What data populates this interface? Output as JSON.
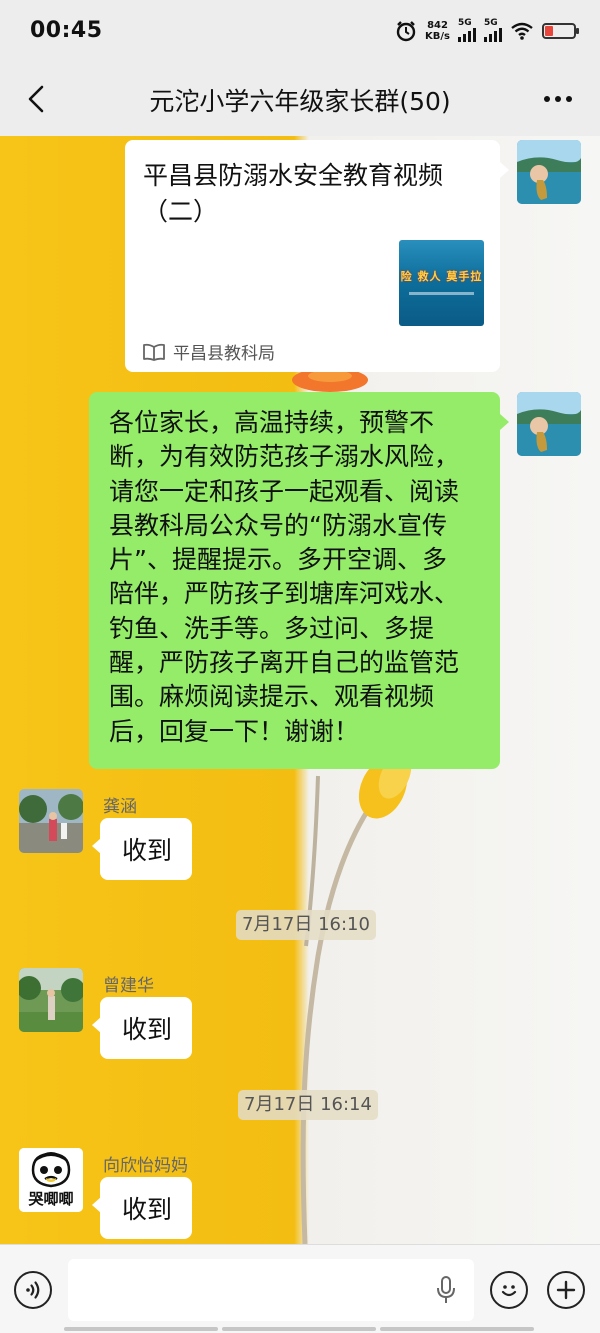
{
  "status_bar": {
    "time": "00:45",
    "net_speed_value": "842",
    "net_speed_unit": "KB/s",
    "signal1": "5G",
    "signal2": "5G",
    "icons": [
      "alarm-icon",
      "signal-icon",
      "signal-icon",
      "wifi-icon",
      "battery-low-icon"
    ],
    "battery_color": "#e6463c"
  },
  "header": {
    "title": "元沱小学六年级家长群(50)",
    "back_icon": "chevron-left-icon",
    "more_icon": "more-dots-icon"
  },
  "messages": [
    {
      "type": "link",
      "side": "right",
      "title": "平昌县防溺水安全教育视频（二）",
      "thumb_text": "险  救人 莫手拉",
      "source": "平昌县教科局",
      "source_icon": "book-icon"
    },
    {
      "type": "text",
      "side": "right",
      "lines": [
        "各位家长，高温持续，预警不",
        "断，为有效防范孩子溺水风险，",
        "请您一定和孩子一起观看、阅读",
        "县教科局公众号的“防溺水宣传",
        "片”、提醒提示。多开空调、多",
        "陪伴，严防孩子到塘库河戏水、",
        "钓鱼、洗手等。多过问、多提",
        "醒，严防孩子离开自己的监管范",
        "围。麻烦阅读提示、观看视频",
        "后，回复一下！谢谢！"
      ]
    },
    {
      "type": "text",
      "side": "left",
      "sender": "龚涵",
      "text": "收到"
    },
    {
      "type": "time",
      "text": "7月17日 16:10"
    },
    {
      "type": "text",
      "side": "left",
      "sender": "曾建华",
      "text": "收到"
    },
    {
      "type": "time",
      "text": "7月17日 16:14"
    },
    {
      "type": "text",
      "side": "left",
      "sender": "向欣怡妈妈",
      "text": "收到",
      "avatar_text": "哭唧唧"
    }
  ],
  "input_bar": {
    "voice_icon": "voice-icon",
    "mic_icon": "mic-icon",
    "emoji_icon": "emoji-icon",
    "add_icon": "plus-icon"
  },
  "colors": {
    "my_bubble": "#95ec69",
    "other_bubble": "#ffffff",
    "wallpaper_yellow": "#f7c418"
  }
}
